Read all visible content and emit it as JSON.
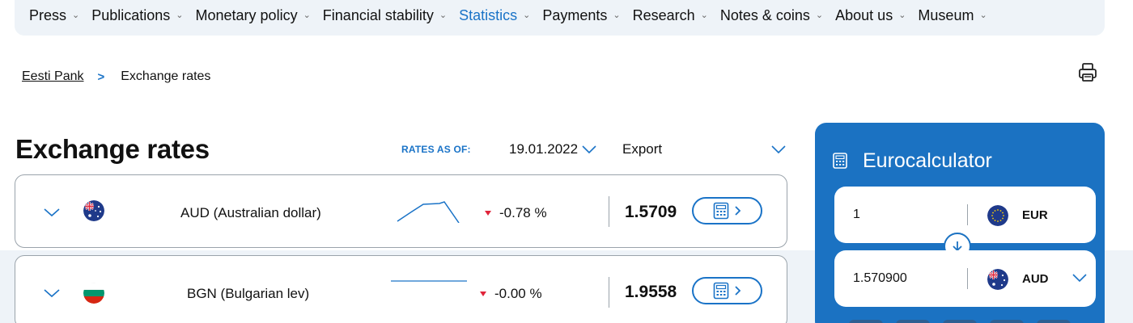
{
  "nav": {
    "items": [
      {
        "label": "Press",
        "active": false
      },
      {
        "label": "Publications",
        "active": false
      },
      {
        "label": "Monetary policy",
        "active": false
      },
      {
        "label": "Financial stability",
        "active": false
      },
      {
        "label": "Statistics",
        "active": true
      },
      {
        "label": "Payments",
        "active": false
      },
      {
        "label": "Research",
        "active": false
      },
      {
        "label": "Notes & coins",
        "active": false
      },
      {
        "label": "About us",
        "active": false
      },
      {
        "label": "Museum",
        "active": false
      }
    ],
    "active_color": "#1a73c7"
  },
  "breadcrumb": {
    "home": "Eesti Pank",
    "separator": ">",
    "current": "Exchange rates"
  },
  "page": {
    "title": "Exchange rates",
    "rates_as_of_label": "RATES AS OF:",
    "date_value": "19.01.2022",
    "export_label": "Export"
  },
  "rates": [
    {
      "code_name": "AUD (Australian dollar)",
      "flag": "australia-flag",
      "change": "-0.78 %",
      "trend": "down",
      "rate": "1.5709"
    },
    {
      "code_name": "BGN (Bulgarian lev)",
      "flag": "bulgaria-flag",
      "change": "-0.00 %",
      "trend": "down",
      "rate": "1.9558"
    }
  ],
  "calculator": {
    "title": "Eurocalculator",
    "from": {
      "value": "1",
      "currency": "EUR",
      "flag": "eu-flag"
    },
    "to": {
      "value": "1.570900",
      "currency": "AUD",
      "flag": "australia-flag"
    }
  },
  "colors": {
    "accent": "#1a73c7",
    "calculator_bg": "#1b72c2",
    "nav_bg": "#eef3f8",
    "negative": "#e0243a"
  }
}
